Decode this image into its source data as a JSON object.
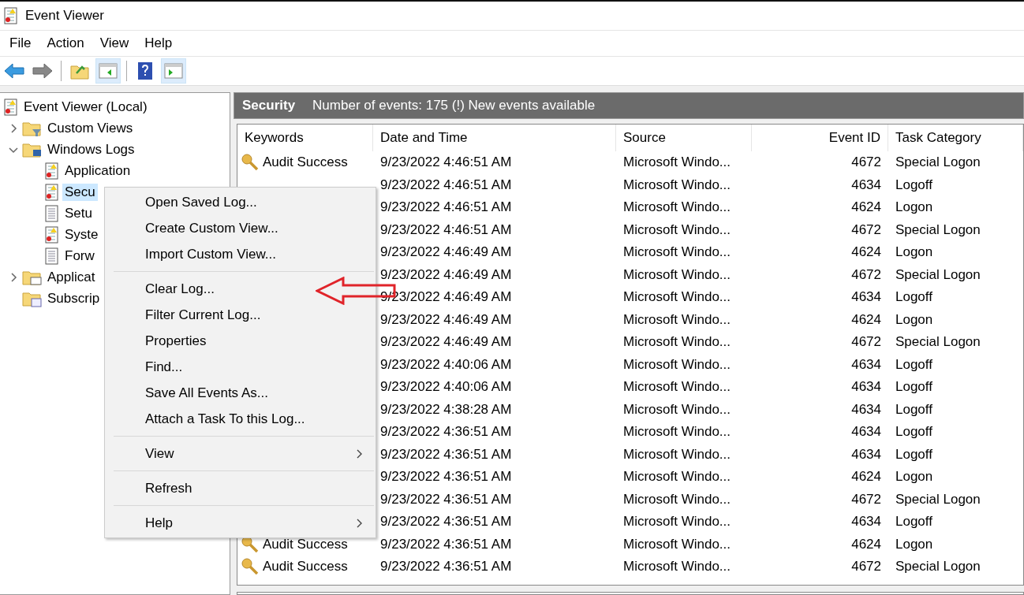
{
  "window": {
    "title": "Event Viewer"
  },
  "menu_bar": [
    "File",
    "Action",
    "View",
    "Help"
  ],
  "toolbar": [
    {
      "kind": "back",
      "pressed": false
    },
    {
      "kind": "forward",
      "pressed": false
    },
    {
      "kind": "sep"
    },
    {
      "kind": "folder",
      "pressed": false
    },
    {
      "kind": "pane",
      "pressed": true
    },
    {
      "kind": "sep"
    },
    {
      "kind": "help",
      "pressed": false
    },
    {
      "kind": "pane2",
      "pressed": true
    }
  ],
  "tree": [
    {
      "label": "Event Viewer (Local)",
      "kind": "log",
      "selected": false,
      "children": [
        {
          "label": "Custom Views",
          "kind": "filter-folder",
          "expanded": false,
          "selected": false
        },
        {
          "label": "Windows Logs",
          "kind": "pc-folder",
          "expanded": true,
          "selected": false,
          "children": [
            {
              "label": "Application",
              "kind": "log",
              "selected": false
            },
            {
              "label": "Secu",
              "kind": "log",
              "selected": true
            },
            {
              "label": "Setu",
              "kind": "page",
              "selected": false
            },
            {
              "label": "Syste",
              "kind": "log",
              "selected": false
            },
            {
              "label": "Forw",
              "kind": "page",
              "selected": false
            }
          ]
        },
        {
          "label": "Applicat",
          "kind": "folder",
          "expanded": false,
          "selected": false
        },
        {
          "label": "Subscrip",
          "kind": "sub-folder",
          "selected": false
        }
      ]
    }
  ],
  "panel_header": {
    "title": "Security",
    "info": "Number of events: 175 (!) New events available"
  },
  "table": {
    "columns": [
      "Keywords",
      "Date and Time",
      "Source",
      "Event ID",
      "Task Category"
    ],
    "rows": [
      {
        "keyword": "Audit Success",
        "date": "9/23/2022 4:46:51 AM",
        "source": "Microsoft Windo...",
        "event_id": "4672",
        "category": "Special Logon"
      },
      {
        "date": "9/23/2022 4:46:51 AM",
        "source": "Microsoft Windo...",
        "event_id": "4634",
        "category": "Logoff"
      },
      {
        "date": "9/23/2022 4:46:51 AM",
        "source": "Microsoft Windo...",
        "event_id": "4624",
        "category": "Logon"
      },
      {
        "date": "9/23/2022 4:46:51 AM",
        "source": "Microsoft Windo...",
        "event_id": "4672",
        "category": "Special Logon"
      },
      {
        "date": "9/23/2022 4:46:49 AM",
        "source": "Microsoft Windo...",
        "event_id": "4624",
        "category": "Logon"
      },
      {
        "date": "9/23/2022 4:46:49 AM",
        "source": "Microsoft Windo...",
        "event_id": "4672",
        "category": "Special Logon"
      },
      {
        "date": "9/23/2022 4:46:49 AM",
        "source": "Microsoft Windo...",
        "event_id": "4634",
        "category": "Logoff"
      },
      {
        "date": "9/23/2022 4:46:49 AM",
        "source": "Microsoft Windo...",
        "event_id": "4624",
        "category": "Logon"
      },
      {
        "date": "9/23/2022 4:46:49 AM",
        "source": "Microsoft Windo...",
        "event_id": "4672",
        "category": "Special Logon"
      },
      {
        "date": "9/23/2022 4:40:06 AM",
        "source": "Microsoft Windo...",
        "event_id": "4634",
        "category": "Logoff"
      },
      {
        "date": "9/23/2022 4:40:06 AM",
        "source": "Microsoft Windo...",
        "event_id": "4634",
        "category": "Logoff"
      },
      {
        "date": "9/23/2022 4:38:28 AM",
        "source": "Microsoft Windo...",
        "event_id": "4634",
        "category": "Logoff"
      },
      {
        "date": "9/23/2022 4:36:51 AM",
        "source": "Microsoft Windo...",
        "event_id": "4634",
        "category": "Logoff"
      },
      {
        "date": "9/23/2022 4:36:51 AM",
        "source": "Microsoft Windo...",
        "event_id": "4634",
        "category": "Logoff"
      },
      {
        "date": "9/23/2022 4:36:51 AM",
        "source": "Microsoft Windo...",
        "event_id": "4624",
        "category": "Logon"
      },
      {
        "date": "9/23/2022 4:36:51 AM",
        "source": "Microsoft Windo...",
        "event_id": "4672",
        "category": "Special Logon"
      },
      {
        "date": "9/23/2022 4:36:51 AM",
        "source": "Microsoft Windo...",
        "event_id": "4634",
        "category": "Logoff"
      },
      {
        "keyword": "Audit Success",
        "date": "9/23/2022 4:36:51 AM",
        "source": "Microsoft Windo...",
        "event_id": "4624",
        "category": "Logon"
      },
      {
        "keyword": "Audit Success",
        "date": "9/23/2022 4:36:51 AM",
        "source": "Microsoft Windo...",
        "event_id": "4672",
        "category": "Special Logon"
      }
    ]
  },
  "context_menu": [
    {
      "kind": "item",
      "label": "Open Saved Log..."
    },
    {
      "kind": "item",
      "label": "Create Custom View..."
    },
    {
      "kind": "item",
      "label": "Import Custom View..."
    },
    {
      "kind": "separator"
    },
    {
      "kind": "item",
      "label": "Clear Log..."
    },
    {
      "kind": "item",
      "label": "Filter Current Log..."
    },
    {
      "kind": "item",
      "label": "Properties"
    },
    {
      "kind": "item",
      "label": "Find..."
    },
    {
      "kind": "item",
      "label": "Save All Events As..."
    },
    {
      "kind": "item",
      "label": "Attach a Task To this Log..."
    },
    {
      "kind": "separator"
    },
    {
      "kind": "submenu",
      "label": "View"
    },
    {
      "kind": "separator"
    },
    {
      "kind": "item",
      "label": "Refresh"
    },
    {
      "kind": "separator"
    },
    {
      "kind": "submenu",
      "label": "Help"
    }
  ],
  "annotation": {
    "kind": "arrow"
  }
}
